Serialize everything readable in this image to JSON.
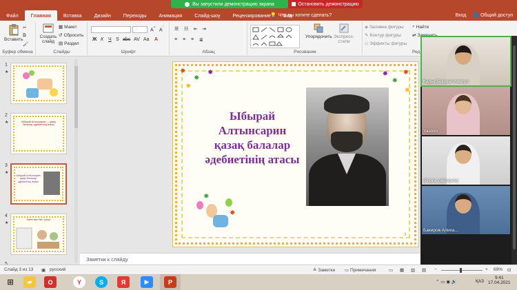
{
  "banner": {
    "sharing_text": "Вы запустили демонстрацию экрана",
    "stop_text": "Остановить демонстрацию"
  },
  "tabs": [
    "Файл",
    "Главная",
    "Вставка",
    "Дизайн",
    "Переходы",
    "Анимация",
    "Слайд-шоу",
    "Рецензирование",
    "Вид"
  ],
  "tell_me": "Что вы хотите сделать?",
  "top_right": {
    "signin": "Вход",
    "share": "Общий доступ"
  },
  "ribbon": {
    "paste": "Вставить",
    "clipboard_label": "Буфер обмена",
    "new_slide": "Создать слайд",
    "layout": "Макет",
    "reset": "Сбросить",
    "section": "Раздел",
    "slides_label": "Слайды",
    "font_label": "Шрифт",
    "paragraph_label": "Абзац",
    "arrange": "Упорядочить",
    "quick_styles": "Экспресс-стили",
    "drawing_label": "Рисование",
    "shape_fill": "Заливка фигуры",
    "shape_outline": "Контур фигуры",
    "shape_effects": "Эффекты фигуры",
    "find": "Найти",
    "replace": "Заменить",
    "editing_label": "Ред"
  },
  "thumbnails": [
    {
      "num": "1",
      "star": "★",
      "text": ""
    },
    {
      "num": "2",
      "star": "★",
      "text": "Ыбырай Алтынсарин — қазақ балалар әдебиетінің атасы"
    },
    {
      "num": "3",
      "star": "★",
      "text": "Ыбырай Алтынсарин қазақ балалар әдебиетінің атасы"
    },
    {
      "num": "4",
      "star": "★",
      "text": "\"Шеге мен бал түсер\""
    },
    {
      "num": "5",
      "star": "",
      "text": ""
    }
  ],
  "slide": {
    "title_lines": [
      "Ыбырай",
      "Алтынсарин",
      "қазақ балалар",
      "әдебиетінің атасы"
    ],
    "page_number": "3"
  },
  "notes_placeholder": "Заметки к слайду",
  "participants": [
    {
      "name": "КадырбековаАлмагул"
    },
    {
      "name": "Yasmin"
    },
    {
      "name": "iPhone (айгерим)"
    },
    {
      "name": "Бакиров Алиха..."
    }
  ],
  "status": {
    "slide_counter": "Слайд 3 из 13",
    "language": "русский",
    "notes": "Заметки",
    "comments": "Примечания",
    "zoom": "69%"
  },
  "taskbar": {
    "lang": "ҚАЗ",
    "time": "9:41",
    "date": "17.04.2021"
  },
  "colors": {
    "accent": "#b7472a",
    "title_purple": "#7a2e96",
    "share_green": "#2fb24b",
    "stop_red": "#c62828"
  }
}
